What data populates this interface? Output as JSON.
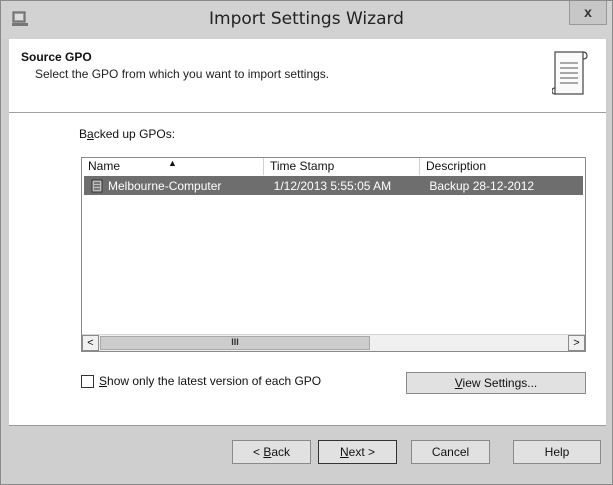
{
  "window": {
    "title": "Import Settings Wizard",
    "close_label": "x"
  },
  "header": {
    "title": "Source GPO",
    "subtitle": "Select the GPO from which you want to import settings."
  },
  "list": {
    "label_pre": "B",
    "label_accel": "a",
    "label_post": "cked up GPOs:",
    "columns": [
      "Name",
      "Time Stamp",
      "Description"
    ],
    "rows": [
      {
        "name": "Melbourne-Computer",
        "time_stamp": "1/12/2013 5:55:05 AM",
        "description": "Backup 28-12-2012",
        "selected": true
      }
    ],
    "scroll_left": "<",
    "scroll_right": ">",
    "scroll_thumb": "III"
  },
  "options": {
    "checkbox_accel": "S",
    "checkbox_label": "how only the latest version of each GPO",
    "checkbox_checked": false,
    "view_accel": "V",
    "view_label": "iew Settings..."
  },
  "buttons": {
    "back_pre": "< ",
    "back_accel": "B",
    "back_post": "ack",
    "next_accel": "N",
    "next_post": "ext >",
    "cancel": "Cancel",
    "help": "Help"
  },
  "colors": {
    "selection": "#6e6e6e",
    "chrome": "#d2d2d2"
  }
}
